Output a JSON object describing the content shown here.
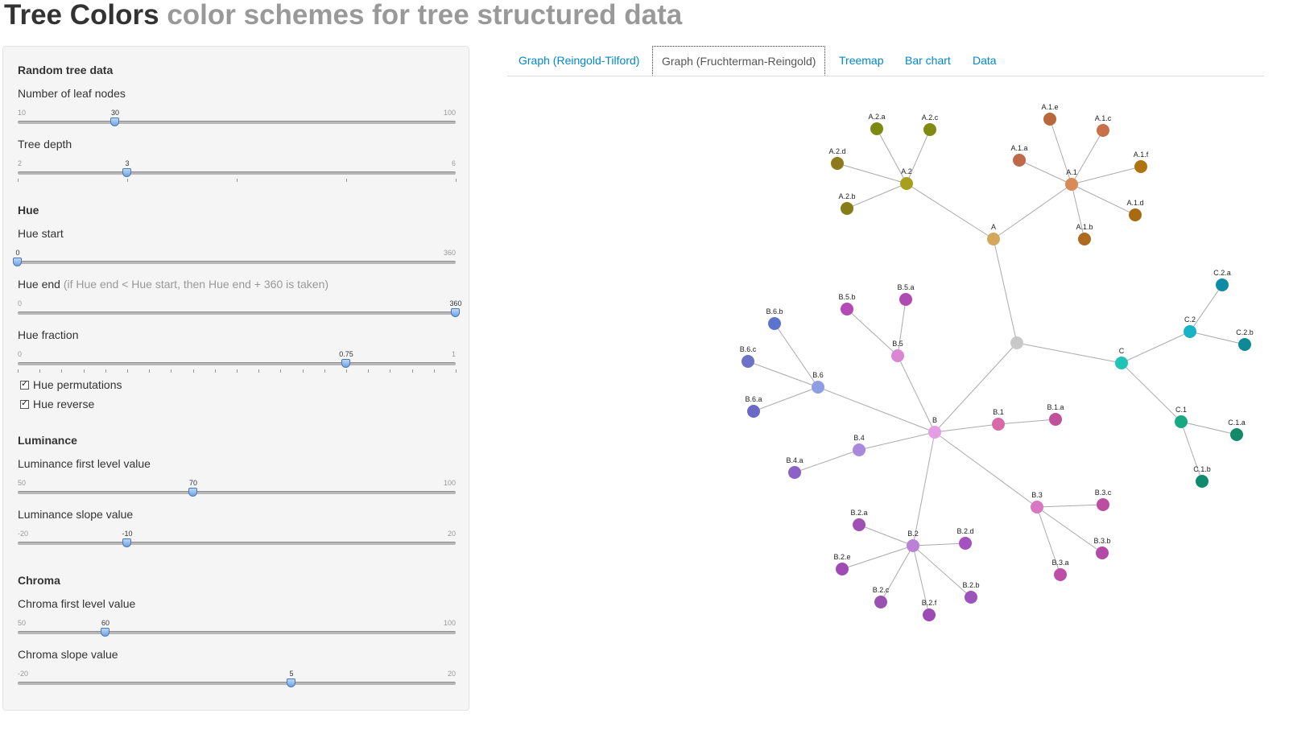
{
  "header": {
    "title": "Tree Colors",
    "subtitle": "color schemes for tree structured data"
  },
  "sections": {
    "random": "Random tree data",
    "hue": "Hue",
    "luminance": "Luminance",
    "chroma": "Chroma"
  },
  "sliders": {
    "leaf_nodes": {
      "label": "Number of leaf nodes",
      "min": "10",
      "max": "100",
      "value": "30",
      "frac": 0.2222
    },
    "depth": {
      "label": "Tree depth",
      "min": "2",
      "max": "6",
      "value": "3",
      "frac": 0.25
    },
    "hue_start": {
      "label": "Hue start",
      "min": "0",
      "max": "360",
      "value": "0",
      "frac": 0
    },
    "hue_end": {
      "label": "Hue end",
      "note": "(if Hue end < Hue start, then Hue end + 360 is taken)",
      "min": "0",
      "max": "360",
      "value": "360",
      "frac": 1
    },
    "hue_fraction": {
      "label": "Hue fraction",
      "min": "0",
      "max": "1",
      "value": "0.75",
      "frac": 0.75
    },
    "lum_first": {
      "label": "Luminance first level value",
      "min": "50",
      "max": "100",
      "value": "70",
      "frac": 0.4
    },
    "lum_slope": {
      "label": "Luminance slope value",
      "min": "-20",
      "max": "20",
      "value": "-10",
      "frac": 0.25
    },
    "chroma_first": {
      "label": "Chroma first level value",
      "min": "50",
      "max": "100",
      "value": "60",
      "frac": 0.2
    },
    "chroma_slope": {
      "label": "Chroma slope value",
      "min": "-20",
      "max": "20",
      "value": "5",
      "frac": 0.625
    }
  },
  "checkboxes": {
    "hue_perm": {
      "label": "Hue permutations",
      "checked": true
    },
    "hue_rev": {
      "label": "Hue reverse",
      "checked": true
    }
  },
  "tabs": [
    {
      "label": "Graph (Reingold-Tilford)"
    },
    {
      "label": "Graph (Fruchterman-Reingold)",
      "active": true
    },
    {
      "label": "Treemap"
    },
    {
      "label": "Bar chart"
    },
    {
      "label": "Data"
    }
  ],
  "graph": {
    "nodes": [
      {
        "id": "root",
        "label": "",
        "color": "#c8c8c8"
      },
      {
        "id": "A",
        "label": "A",
        "color": "#d4a85c"
      },
      {
        "id": "A.1",
        "label": "A.1",
        "color": "#d98a55"
      },
      {
        "id": "A.1.a",
        "label": "A.1.a",
        "color": "#c0684a"
      },
      {
        "id": "A.1.b",
        "label": "A.1.b",
        "color": "#ad6a1e"
      },
      {
        "id": "A.1.c",
        "label": "A.1.c",
        "color": "#c87049"
      },
      {
        "id": "A.1.d",
        "label": "A.1.d",
        "color": "#a86a12"
      },
      {
        "id": "A.1.e",
        "label": "A.1.e",
        "color": "#b8683a"
      },
      {
        "id": "A.1.f",
        "label": "A.1.f",
        "color": "#b07312"
      },
      {
        "id": "A.2",
        "label": "A.2",
        "color": "#a6a01e"
      },
      {
        "id": "A.2.a",
        "label": "A.2.a",
        "color": "#7c8a12"
      },
      {
        "id": "A.2.b",
        "label": "A.2.b",
        "color": "#857e18"
      },
      {
        "id": "A.2.c",
        "label": "A.2.c",
        "color": "#808a12"
      },
      {
        "id": "A.2.d",
        "label": "A.2.d",
        "color": "#8c7a1c"
      },
      {
        "id": "B",
        "label": "B",
        "color": "#e49fe4"
      },
      {
        "id": "B.1",
        "label": "B.1",
        "color": "#d66aa6"
      },
      {
        "id": "B.1.a",
        "label": "B.1.a",
        "color": "#c1509a"
      },
      {
        "id": "B.2",
        "label": "B.2",
        "color": "#b982d6"
      },
      {
        "id": "B.2.a",
        "label": "B.2.a",
        "color": "#a050b4"
      },
      {
        "id": "B.2.b",
        "label": "B.2.b",
        "color": "#9c54bc"
      },
      {
        "id": "B.2.c",
        "label": "B.2.c",
        "color": "#9a52b2"
      },
      {
        "id": "B.2.d",
        "label": "B.2.d",
        "color": "#a452c0"
      },
      {
        "id": "B.2.e",
        "label": "B.2.e",
        "color": "#a04ab6"
      },
      {
        "id": "B.2.f",
        "label": "B.2.f",
        "color": "#9c4ab4"
      },
      {
        "id": "B.3",
        "label": "B.3",
        "color": "#d878c2"
      },
      {
        "id": "B.3.a",
        "label": "B.3.a",
        "color": "#bc4ea6"
      },
      {
        "id": "B.3.b",
        "label": "B.3.b",
        "color": "#b44aa8"
      },
      {
        "id": "B.3.c",
        "label": "B.3.c",
        "color": "#bc4ea2"
      },
      {
        "id": "B.4",
        "label": "B.4",
        "color": "#a889dc"
      },
      {
        "id": "B.4.a",
        "label": "B.4.a",
        "color": "#8c62c4"
      },
      {
        "id": "B.5",
        "label": "B.5",
        "color": "#da86d2"
      },
      {
        "id": "B.5.a",
        "label": "B.5.a",
        "color": "#b04cb0"
      },
      {
        "id": "B.5.b",
        "label": "B.5.b",
        "color": "#b44ab6"
      },
      {
        "id": "B.6",
        "label": "B.6",
        "color": "#8f9ee2"
      },
      {
        "id": "B.6.a",
        "label": "B.6.a",
        "color": "#6a6ac6"
      },
      {
        "id": "B.6.b",
        "label": "B.6.b",
        "color": "#5c74ca"
      },
      {
        "id": "B.6.c",
        "label": "B.6.c",
        "color": "#6b72c8"
      },
      {
        "id": "C",
        "label": "C",
        "color": "#1fc4b6"
      },
      {
        "id": "C.1",
        "label": "C.1",
        "color": "#18a882"
      },
      {
        "id": "C.1.a",
        "label": "C.1.a",
        "color": "#128a6a"
      },
      {
        "id": "C.1.b",
        "label": "C.1.b",
        "color": "#0f8a6e"
      },
      {
        "id": "C.2",
        "label": "C.2",
        "color": "#1ab2c6"
      },
      {
        "id": "C.2.a",
        "label": "C.2.a",
        "color": "#0e8ca6"
      },
      {
        "id": "C.2.b",
        "label": "C.2.b",
        "color": "#0e8a96"
      }
    ],
    "edges": [
      [
        "root",
        "A"
      ],
      [
        "root",
        "B"
      ],
      [
        "root",
        "C"
      ],
      [
        "A",
        "A.1"
      ],
      [
        "A",
        "A.2"
      ],
      [
        "A.1",
        "A.1.a"
      ],
      [
        "A.1",
        "A.1.b"
      ],
      [
        "A.1",
        "A.1.c"
      ],
      [
        "A.1",
        "A.1.d"
      ],
      [
        "A.1",
        "A.1.e"
      ],
      [
        "A.1",
        "A.1.f"
      ],
      [
        "A.2",
        "A.2.a"
      ],
      [
        "A.2",
        "A.2.b"
      ],
      [
        "A.2",
        "A.2.c"
      ],
      [
        "A.2",
        "A.2.d"
      ],
      [
        "B",
        "B.1"
      ],
      [
        "B",
        "B.2"
      ],
      [
        "B",
        "B.3"
      ],
      [
        "B",
        "B.4"
      ],
      [
        "B",
        "B.5"
      ],
      [
        "B",
        "B.6"
      ],
      [
        "B.1",
        "B.1.a"
      ],
      [
        "B.2",
        "B.2.a"
      ],
      [
        "B.2",
        "B.2.b"
      ],
      [
        "B.2",
        "B.2.c"
      ],
      [
        "B.2",
        "B.2.d"
      ],
      [
        "B.2",
        "B.2.e"
      ],
      [
        "B.2",
        "B.2.f"
      ],
      [
        "B.3",
        "B.3.a"
      ],
      [
        "B.3",
        "B.3.b"
      ],
      [
        "B.3",
        "B.3.c"
      ],
      [
        "B.4",
        "B.4.a"
      ],
      [
        "B.5",
        "B.5.a"
      ],
      [
        "B.5",
        "B.5.b"
      ],
      [
        "B.6",
        "B.6.a"
      ],
      [
        "B.6",
        "B.6.b"
      ],
      [
        "B.6",
        "B.6.c"
      ],
      [
        "C",
        "C.1"
      ],
      [
        "C",
        "C.2"
      ],
      [
        "C.1",
        "C.1.a"
      ],
      [
        "C.1",
        "C.1.b"
      ],
      [
        "C.2",
        "C.2.a"
      ],
      [
        "C.2",
        "C.2.b"
      ]
    ]
  }
}
